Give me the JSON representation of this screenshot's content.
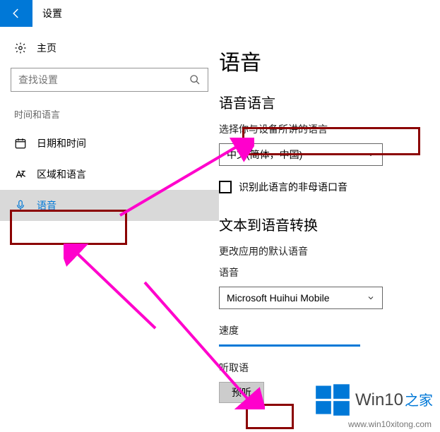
{
  "titlebar": {
    "title": "设置"
  },
  "sidebar": {
    "home_label": "主页",
    "search_placeholder": "查找设置",
    "group_label": "时间和语言",
    "items": [
      {
        "label": "日期和时间",
        "icon": "clock-icon"
      },
      {
        "label": "区域和语言",
        "icon": "language-icon"
      },
      {
        "label": "语音",
        "icon": "microphone-icon"
      }
    ]
  },
  "content": {
    "page_title": "语音",
    "section_lang": {
      "heading": "语音语言",
      "desc": "选择你与设备所讲的语言",
      "dropdown_value": "中文(简体，中国)",
      "checkbox_label": "识别此语言的非母语口音"
    },
    "section_tts": {
      "heading": "文本到语音转换",
      "desc": "更改应用的默认语音",
      "voice_label": "语音",
      "voice_dropdown_value": "Microsoft Huihui Mobile",
      "speed_label": "速度",
      "preview_heading": "听取语",
      "preview_button": "预听"
    }
  },
  "watermark": {
    "brand": "Win10",
    "suffix": "之家",
    "url": "www.win10xitong.com"
  }
}
